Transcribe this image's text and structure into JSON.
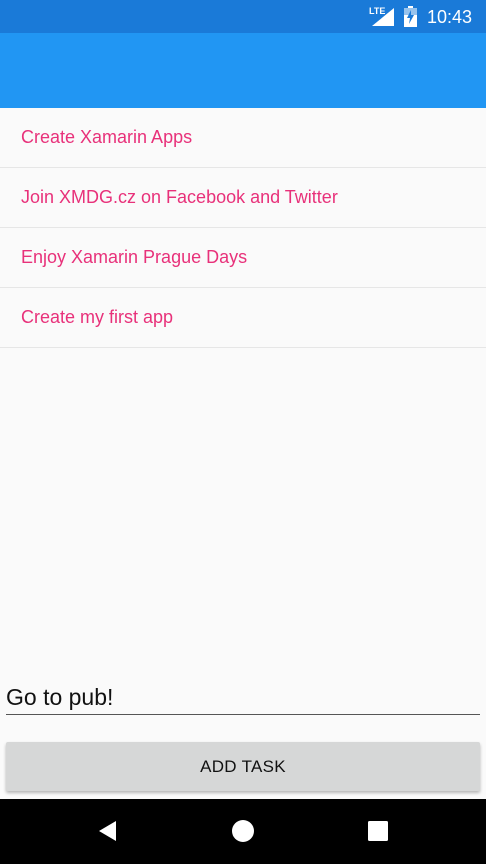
{
  "status_bar": {
    "network_label": "LTE",
    "time": "10:43",
    "icons": [
      "lte-signal-icon",
      "battery-charging-icon"
    ]
  },
  "task_list": {
    "items": [
      {
        "label": "Create Xamarin Apps"
      },
      {
        "label": "Join XMDG.cz on Facebook and Twitter"
      },
      {
        "label": "Enjoy Xamarin Prague Days"
      },
      {
        "label": "Create my first app"
      }
    ]
  },
  "entry": {
    "value": "Go to pub!"
  },
  "add_button": {
    "label": "ADD TASK"
  },
  "nav_bar": {
    "icons": [
      "back-icon",
      "home-icon",
      "recents-icon"
    ]
  },
  "colors": {
    "status_bar": "#1a7ad8",
    "app_bar": "#2196f3",
    "task_text": "#e8317a",
    "button_bg": "#d6d7d7"
  }
}
